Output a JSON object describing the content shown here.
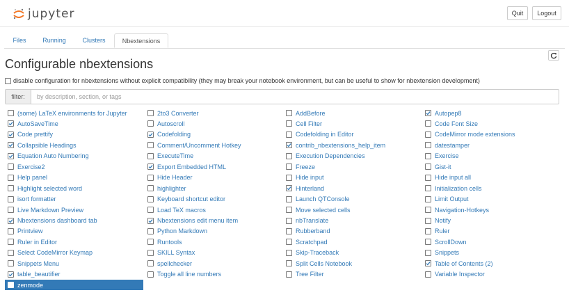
{
  "header": {
    "logo_text": "jupyter",
    "quit_label": "Quit",
    "logout_label": "Logout"
  },
  "tabs": [
    {
      "label": "Files",
      "active": false
    },
    {
      "label": "Running",
      "active": false
    },
    {
      "label": "Clusters",
      "active": false
    },
    {
      "label": "Nbextensions",
      "active": true
    }
  ],
  "page": {
    "title": "Configurable nbextensions",
    "disable_compat_label": "disable configuration for nbextensions without explicit compatibility (they may break your notebook environment, but can be useful to show for nbextension development)",
    "disable_compat_checked": false
  },
  "filter": {
    "label": "filter:",
    "placeholder": "by description, section, or tags"
  },
  "columns": [
    [
      {
        "label": "(some) LaTeX environments for Jupyter",
        "checked": false
      },
      {
        "label": "AutoSaveTime",
        "checked": true
      },
      {
        "label": "Code prettify",
        "checked": true
      },
      {
        "label": "Collapsible Headings",
        "checked": true
      },
      {
        "label": "Equation Auto Numbering",
        "checked": true
      },
      {
        "label": "Exercise2",
        "checked": false
      },
      {
        "label": "Help panel",
        "checked": false
      },
      {
        "label": "Highlight selected word",
        "checked": false
      },
      {
        "label": "isort formatter",
        "checked": false
      },
      {
        "label": "Live Markdown Preview",
        "checked": false
      },
      {
        "label": "Nbextensions dashboard tab",
        "checked": true
      },
      {
        "label": "Printview",
        "checked": false
      },
      {
        "label": "Ruler in Editor",
        "checked": false
      },
      {
        "label": "Select CodeMirror Keymap",
        "checked": false
      },
      {
        "label": "Snippets Menu",
        "checked": false
      },
      {
        "label": "table_beautifier",
        "checked": true
      },
      {
        "label": "zenmode",
        "checked": false,
        "selected": true
      }
    ],
    [
      {
        "label": "2to3 Converter",
        "checked": false
      },
      {
        "label": "Autoscroll",
        "checked": false
      },
      {
        "label": "Codefolding",
        "checked": true
      },
      {
        "label": "Comment/Uncomment Hotkey",
        "checked": false
      },
      {
        "label": "ExecuteTime",
        "checked": false
      },
      {
        "label": "Export Embedded HTML",
        "checked": true
      },
      {
        "label": "Hide Header",
        "checked": false
      },
      {
        "label": "highlighter",
        "checked": false
      },
      {
        "label": "Keyboard shortcut editor",
        "checked": false
      },
      {
        "label": "Load TeX macros",
        "checked": false
      },
      {
        "label": "Nbextensions edit menu item",
        "checked": true
      },
      {
        "label": "Python Markdown",
        "checked": false
      },
      {
        "label": "Runtools",
        "checked": false
      },
      {
        "label": "SKILL Syntax",
        "checked": false
      },
      {
        "label": "spellchecker",
        "checked": false
      },
      {
        "label": "Toggle all line numbers",
        "checked": false
      }
    ],
    [
      {
        "label": "AddBefore",
        "checked": false
      },
      {
        "label": "Cell Filter",
        "checked": false
      },
      {
        "label": "Codefolding in Editor",
        "checked": false
      },
      {
        "label": "contrib_nbextensions_help_item",
        "checked": true
      },
      {
        "label": "Execution Dependencies",
        "checked": false
      },
      {
        "label": "Freeze",
        "checked": false
      },
      {
        "label": "Hide input",
        "checked": false
      },
      {
        "label": "Hinterland",
        "checked": true
      },
      {
        "label": "Launch QTConsole",
        "checked": false
      },
      {
        "label": "Move selected cells",
        "checked": false
      },
      {
        "label": "nbTranslate",
        "checked": false
      },
      {
        "label": "Rubberband",
        "checked": false
      },
      {
        "label": "Scratchpad",
        "checked": false
      },
      {
        "label": "Skip-Traceback",
        "checked": false
      },
      {
        "label": "Split Cells Notebook",
        "checked": false
      },
      {
        "label": "Tree Filter",
        "checked": false
      }
    ],
    [
      {
        "label": "Autopep8",
        "checked": true
      },
      {
        "label": "Code Font Size",
        "checked": false
      },
      {
        "label": "CodeMirror mode extensions",
        "checked": false
      },
      {
        "label": "datestamper",
        "checked": false
      },
      {
        "label": "Exercise",
        "checked": false
      },
      {
        "label": "Gist-it",
        "checked": false
      },
      {
        "label": "Hide input all",
        "checked": false
      },
      {
        "label": "Initialization cells",
        "checked": false
      },
      {
        "label": "Limit Output",
        "checked": false
      },
      {
        "label": "Navigation-Hotkeys",
        "checked": false
      },
      {
        "label": "Notify",
        "checked": false
      },
      {
        "label": "Ruler",
        "checked": false
      },
      {
        "label": "ScrollDown",
        "checked": false
      },
      {
        "label": "Snippets",
        "checked": false
      },
      {
        "label": "Table of Contents (2)",
        "checked": true
      },
      {
        "label": "Variable Inspector",
        "checked": false
      }
    ]
  ],
  "colors": {
    "link": "#337ab7",
    "logo_orange": "#f37726",
    "logo_grey": "#767677"
  }
}
